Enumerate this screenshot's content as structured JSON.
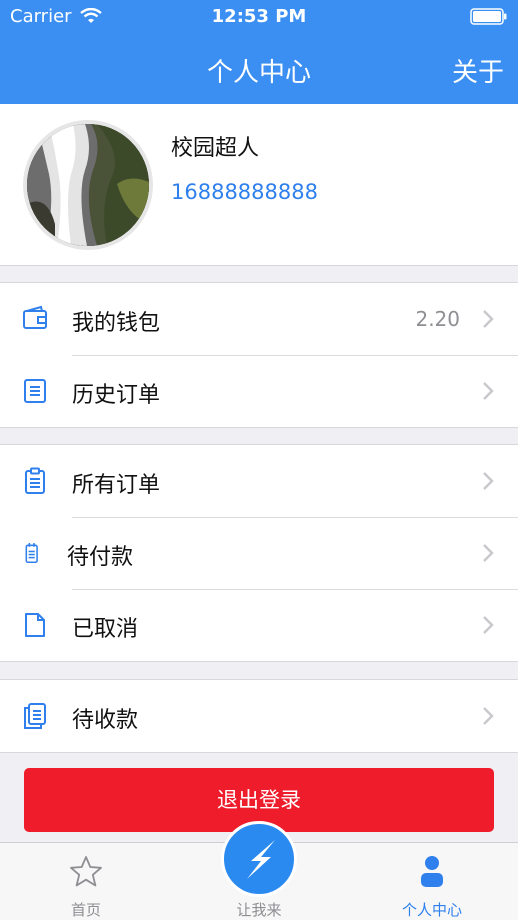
{
  "status_bar": {
    "carrier": "Carrier",
    "time": "12:53 PM"
  },
  "nav": {
    "title": "个人中心",
    "right": "关于"
  },
  "profile": {
    "name": "校园超人",
    "phone": "16888888888"
  },
  "groups": [
    [
      {
        "label": "我的钱包",
        "value": "2.20",
        "icon": "wallet-icon"
      },
      {
        "label": "历史订单",
        "icon": "list-icon"
      }
    ],
    [
      {
        "label": "所有订单",
        "icon": "clipboard-icon"
      },
      {
        "label": "待付款",
        "icon": "notepad-icon"
      },
      {
        "label": "已取消",
        "icon": "document-icon"
      }
    ],
    [
      {
        "label": "待收款",
        "icon": "receipt-icon"
      }
    ]
  ],
  "logout_label": "退出登录",
  "tabs": [
    {
      "label": "首页",
      "icon": "star-icon"
    },
    {
      "label": "让我来",
      "icon": "lightning-icon"
    },
    {
      "label": "个人中心",
      "icon": "person-icon",
      "active": true
    }
  ],
  "colors": {
    "primary": "#3b8ff2",
    "danger": "#ef1c2c",
    "link": "#2f80ed"
  }
}
